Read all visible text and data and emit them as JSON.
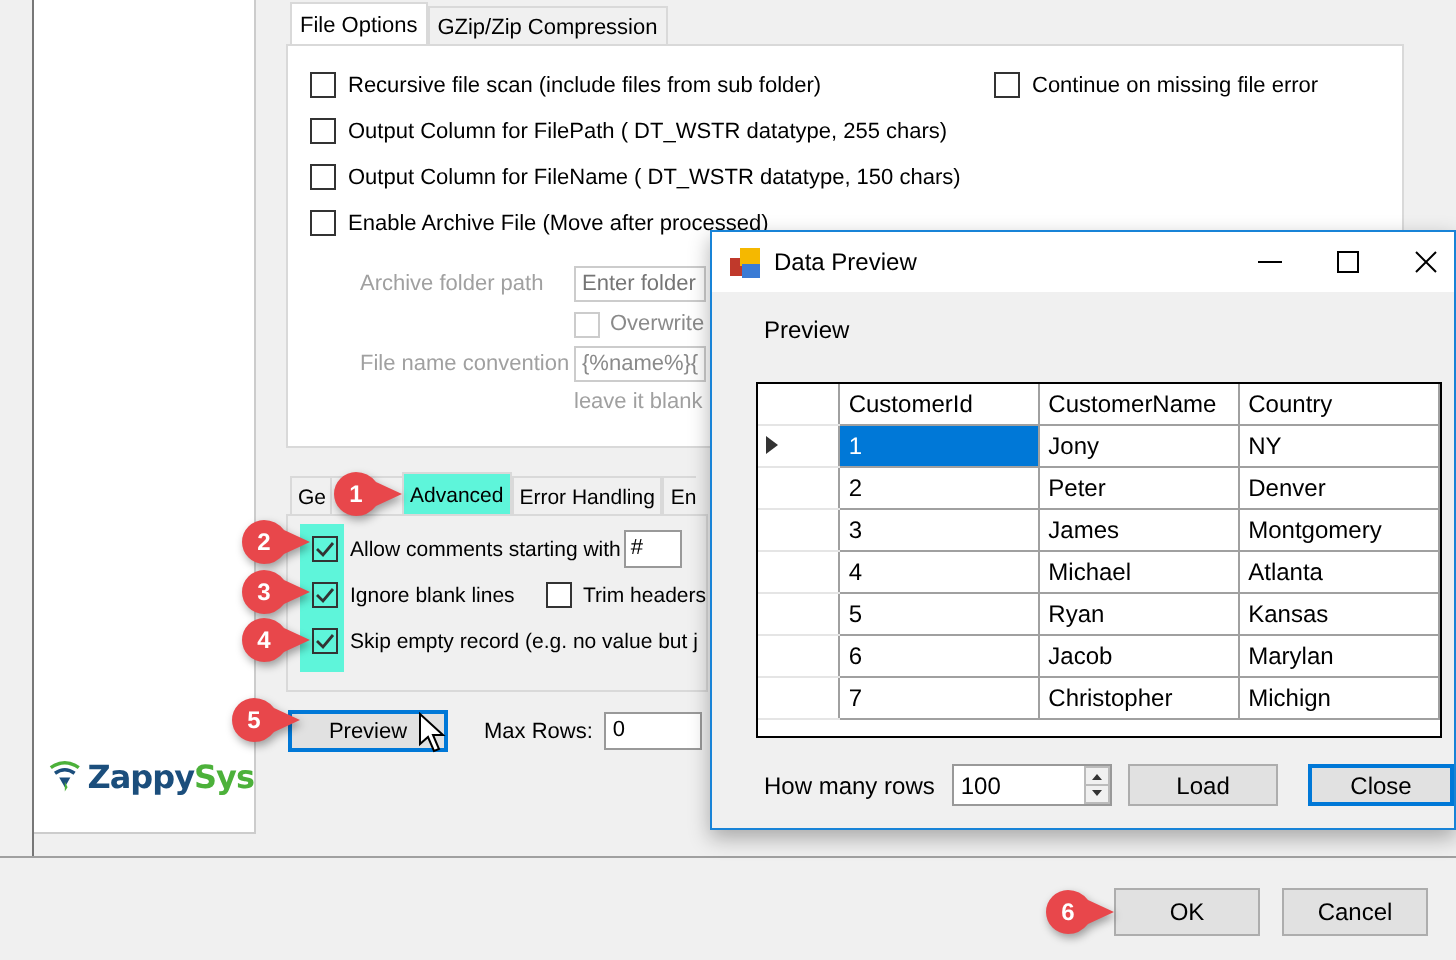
{
  "main": {
    "file_tabs": [
      {
        "label": "File Options",
        "selected": true
      },
      {
        "label": "GZip/Zip Compression",
        "selected": false
      }
    ],
    "file_options": [
      {
        "label": "Recursive file scan (include files from sub folder)",
        "checked": false
      },
      {
        "label": "Output Column for FilePath ( DT_WSTR datatype, 255 chars)",
        "checked": false
      },
      {
        "label": "Output Column for FileName ( DT_WSTR datatype, 150 chars)",
        "checked": false
      },
      {
        "label": "Enable Archive File (Move after processed)",
        "checked": false
      }
    ],
    "side_option": {
      "label": "Continue on missing file error",
      "checked": false
    },
    "archive": {
      "disabled": true,
      "folder_label": "Archive folder path",
      "folder_placeholder": "Enter folder",
      "overwrite": {
        "label": "Overwrite",
        "checked": false
      },
      "convention_label": "File name convention",
      "convention_value": "{%name%}{",
      "hint": "leave it blank"
    },
    "advanced_tabs": [
      {
        "label": "Ge",
        "selected": false
      },
      {
        "label": "Advanced",
        "selected": true
      },
      {
        "label": "Error Handling",
        "selected": false
      },
      {
        "label": "En",
        "selected": false
      }
    ],
    "advanced_options": [
      {
        "label": "Allow comments starting with",
        "checked": true,
        "value": "#"
      },
      {
        "label": "Ignore blank lines",
        "checked": true,
        "extra": {
          "label": "Trim headers",
          "checked": false
        }
      },
      {
        "label": "Skip empty record (e.g. no value but j",
        "checked": true
      }
    ],
    "preview_button": "Preview",
    "max_rows": {
      "label": "Max Rows:",
      "value": "0"
    },
    "logo": [
      "Zappy",
      "Sys"
    ],
    "buttons": [
      "OK",
      "Cancel"
    ]
  },
  "dialog": {
    "title": "Data Preview",
    "caption": "Preview",
    "columns": [
      "CustomerId",
      "CustomerName",
      "Country"
    ],
    "rows": [
      {
        "cells": [
          "1",
          "Jony",
          "NY"
        ],
        "selected": true
      },
      {
        "cells": [
          "2",
          "Peter",
          "Denver"
        ],
        "selected": false
      },
      {
        "cells": [
          "3",
          "James",
          "Montgomery"
        ],
        "selected": false
      },
      {
        "cells": [
          "4",
          "Michael",
          "Atlanta"
        ],
        "selected": false
      },
      {
        "cells": [
          "5",
          "Ryan",
          "Kansas"
        ],
        "selected": false
      },
      {
        "cells": [
          "6",
          "Jacob",
          "Marylan"
        ],
        "selected": false
      },
      {
        "cells": [
          "7",
          "Christopher",
          "Michign"
        ],
        "selected": false
      }
    ],
    "rows_label": "How many rows",
    "rows_value": "100",
    "buttons": [
      "Load",
      "Close"
    ]
  },
  "callouts": [
    "1",
    "2",
    "3",
    "4",
    "5",
    "6"
  ]
}
